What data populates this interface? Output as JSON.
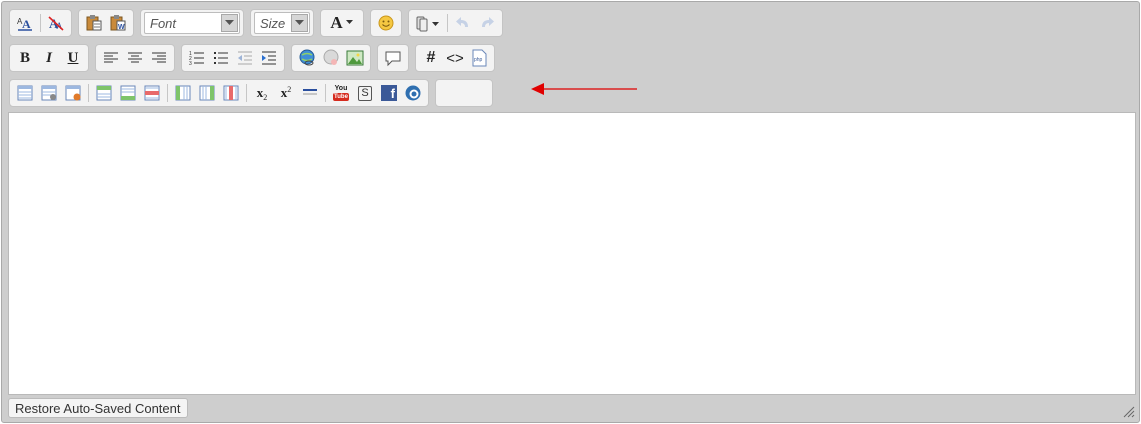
{
  "toolbar": {
    "font_placeholder": "Font",
    "size_placeholder": "Size",
    "font_color_label": "A",
    "bold_label": "B",
    "italic_label": "I",
    "underline_label": "U",
    "anchor_label": "#",
    "source_label": "<>",
    "subscript_label": "x",
    "subscript_sub": "2",
    "superscript_label": "x",
    "superscript_sup": "2",
    "youtube_top": "You",
    "youtube_bottom": "Tube",
    "facebook_label": "f",
    "php_label": "php",
    "strike_label": "S"
  },
  "footer": {
    "restore_label": "Restore Auto-Saved Content"
  },
  "colors": {
    "annotation_arrow": "#e00000",
    "editor_bg": "#cecece"
  },
  "icons": [
    "spellcheck-icon",
    "remove-format-icon",
    "paste-text-icon",
    "paste-word-icon",
    "font-color-icon",
    "emoticon-icon",
    "attachment-icon",
    "undo-icon",
    "redo-icon",
    "bold-icon",
    "italic-icon",
    "underline-icon",
    "align-left-icon",
    "align-center-icon",
    "align-right-icon",
    "numbered-list-icon",
    "bullet-list-icon",
    "outdent-icon",
    "indent-icon",
    "link-icon",
    "unlink-icon",
    "image-icon",
    "comment-icon",
    "anchor-icon",
    "source-icon",
    "php-icon",
    "table-icon",
    "table-props-icon",
    "cell-delete-icon",
    "row-before-icon",
    "row-after-icon",
    "row-delete-icon",
    "col-before-icon",
    "col-after-icon",
    "col-delete-icon",
    "subscript-icon",
    "superscript-icon",
    "horizontal-rule-icon",
    "youtube-icon",
    "strike-icon",
    "facebook-icon",
    "media-icon"
  ]
}
